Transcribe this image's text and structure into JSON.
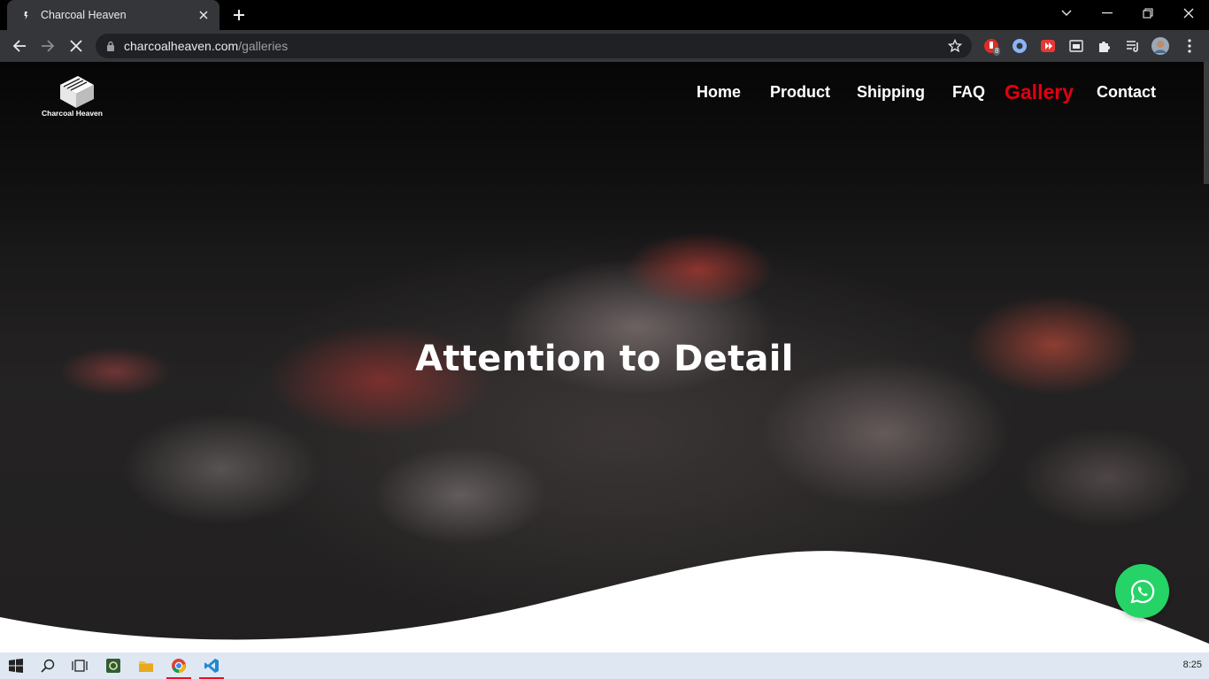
{
  "browser": {
    "tab": {
      "title": "Charcoal Heaven",
      "favicon": "charcoal-favicon"
    },
    "new_tab_icon": "plus-icon",
    "address": {
      "host": "charcoalheaven.com",
      "path": "/galleries"
    },
    "extension_badge": "8"
  },
  "site": {
    "logo_text": "Charcoal Heaven",
    "nav": [
      {
        "label": "Home",
        "active": false
      },
      {
        "label": "Product",
        "active": false
      },
      {
        "label": "Shipping",
        "active": false
      },
      {
        "label": "FAQ",
        "active": false
      },
      {
        "label": "Gallery",
        "active": true
      },
      {
        "label": "Contact",
        "active": false
      }
    ],
    "hero_title": "Attention to Detail",
    "accent_color": "#e3000f",
    "whatsapp_color": "#25d366"
  },
  "taskbar": {
    "clock": "8:25"
  }
}
